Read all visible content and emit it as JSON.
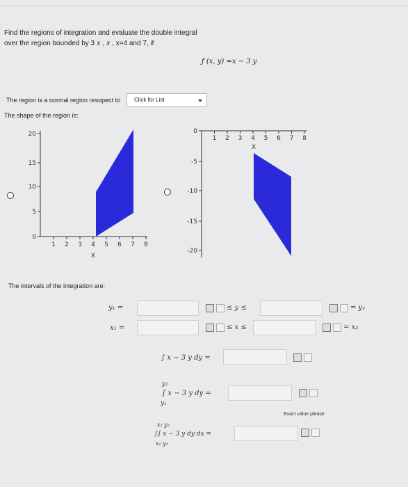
{
  "problem": {
    "line1": "Find the regions of integration and evaluate the double integral",
    "line2": "over the region bounded by 3 𝑥 , 𝑥 , x=4 and  7, if",
    "function": "ƒ (𝑥, 𝑦) =𝑥 − 3 𝑦"
  },
  "region_type": {
    "label": "The region is a normal region resopect to",
    "select_value": "Click for List"
  },
  "shape_label": "The shape of the region is:",
  "graph_a": {
    "x_ticks": [
      "1",
      "2",
      "3",
      "4",
      "5",
      "6",
      "7",
      "8"
    ],
    "y_ticks": [
      "0",
      "5",
      "10",
      "15",
      "20"
    ],
    "xlabel": "X",
    "polygon_color": "#2a2ad8"
  },
  "graph_b": {
    "x_ticks": [
      "1",
      "2",
      "3",
      "4",
      "5",
      "6",
      "7",
      "8"
    ],
    "y_ticks": [
      "0",
      "-5",
      "-10",
      "-15",
      "-20"
    ],
    "xlabel": "X",
    "polygon_color": "#2a2ad8"
  },
  "intervals_label": "The intervals of the integration are:",
  "intervals": {
    "y1": "𝑦₁ =",
    "x1": "𝑥₁ =",
    "y_rel": "≤ 𝑦 ≤",
    "x_rel": "≤ 𝑥 ≤",
    "y2": "= 𝑦₂",
    "x2": "= 𝑥₂"
  },
  "integrals": {
    "inner": "∫ 𝑥 − 3 𝑦  𝑑𝑦 =",
    "definite_top": "𝑦₂",
    "definite_body": "∫ 𝑥 − 3 𝑦  𝑑𝑦 =",
    "definite_bottom": "𝑦₁",
    "exact_note": "Exact value please",
    "double_top": "𝑥₂ 𝑦₂",
    "double_body": "∫∫ 𝑥 − 3 𝑦 𝑑𝑦  𝑑𝑥 =",
    "double_bottom": "𝑥₁ 𝑦₁"
  }
}
